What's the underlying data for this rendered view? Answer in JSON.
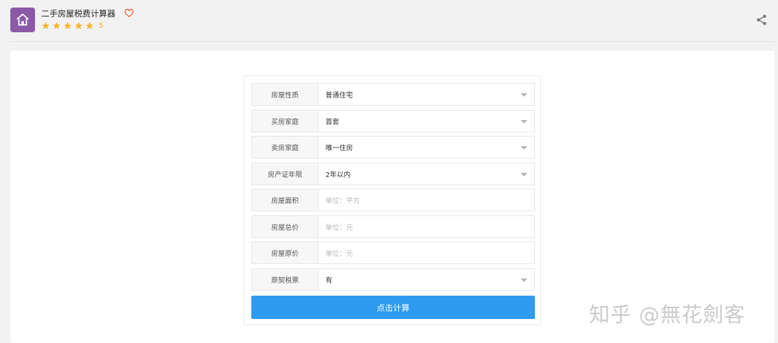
{
  "header": {
    "title": "二手房屋税费计算器",
    "rating_value": "5",
    "star_count": 5,
    "accent_color": "#8a5aa6",
    "star_color": "#f5b52a",
    "favorite_icon": "heart-icon",
    "share_icon": "share-icon",
    "app_icon": "house-icon"
  },
  "form": {
    "rows": [
      {
        "label": "房屋性质",
        "value": "普通住宅",
        "type": "select"
      },
      {
        "label": "买房家庭",
        "value": "首套",
        "type": "select"
      },
      {
        "label": "卖房家庭",
        "value": "唯一住房",
        "type": "select"
      },
      {
        "label": "房产证年限",
        "value": "2年以内",
        "type": "select"
      },
      {
        "label": "房屋面积",
        "placeholder": "单位：平方",
        "type": "input"
      },
      {
        "label": "房屋总价",
        "placeholder": "单位：元",
        "type": "input"
      },
      {
        "label": "房屋原价",
        "placeholder": "单位：元",
        "type": "input"
      },
      {
        "label": "原契税票",
        "value": "有",
        "type": "select"
      }
    ],
    "submit_label": "点击计算",
    "submit_color": "#2e9bf0"
  },
  "watermark": "知乎 @無花劍客"
}
